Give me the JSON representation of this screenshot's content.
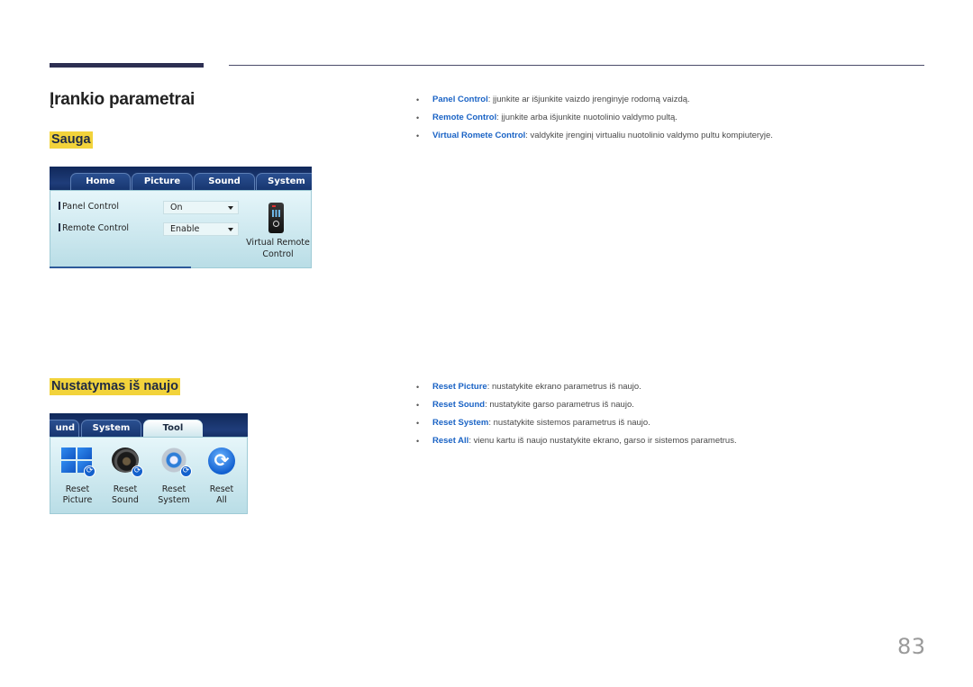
{
  "page": {
    "title": "Įrankio parametrai",
    "page_number": "83",
    "colors": {
      "header_bar": "#2d2f52",
      "heading_highlight": "#f2d33b",
      "term_blue": "#1a63c5"
    }
  },
  "sections": [
    {
      "heading": "Sauga",
      "panel": {
        "tabs": [
          "Home",
          "Picture",
          "Sound",
          "System"
        ],
        "rows": [
          {
            "label": "Panel Control",
            "value": "On"
          },
          {
            "label": "Remote Control",
            "value": "Enable"
          }
        ],
        "icon_button": {
          "icon": "remote-control-icon",
          "label_line1": "Virtual Remote",
          "label_line2": "Control"
        }
      },
      "bullets": [
        {
          "term": "Panel Control",
          "text": ": įjunkite ar išjunkite vaizdo įrenginyje rodomą vaizdą."
        },
        {
          "term": "Remote Control",
          "text": ": įjunkite arba išjunkite nuotolinio valdymo pultą."
        },
        {
          "term": "Virtual Romete Control",
          "text": ": valdykite įrenginį virtualiu nuotolinio valdymo pultu kompiuteryje."
        }
      ]
    },
    {
      "heading": "Nustatymas iš naujo",
      "panel": {
        "tabs": [
          "und",
          "System",
          "Tool"
        ],
        "active_tab": "Tool",
        "icons": [
          {
            "icon": "reset-picture-icon",
            "line1": "Reset",
            "line2": "Picture"
          },
          {
            "icon": "reset-sound-icon",
            "line1": "Reset",
            "line2": "Sound"
          },
          {
            "icon": "reset-system-icon",
            "line1": "Reset",
            "line2": "System"
          },
          {
            "icon": "reset-all-icon",
            "line1": "Reset",
            "line2": "All"
          }
        ]
      },
      "bullets": [
        {
          "term": "Reset Picture",
          "text": ": nustatykite ekrano parametrus iš naujo."
        },
        {
          "term": "Reset Sound",
          "text": ": nustatykite garso parametrus iš naujo."
        },
        {
          "term": "Reset System",
          "text": ": nustatykite sistemos parametrus iš naujo."
        },
        {
          "term": "Reset All",
          "text": ": vienu kartu iš naujo nustatykite ekrano, garso ir sistemos parametrus."
        }
      ]
    }
  ]
}
